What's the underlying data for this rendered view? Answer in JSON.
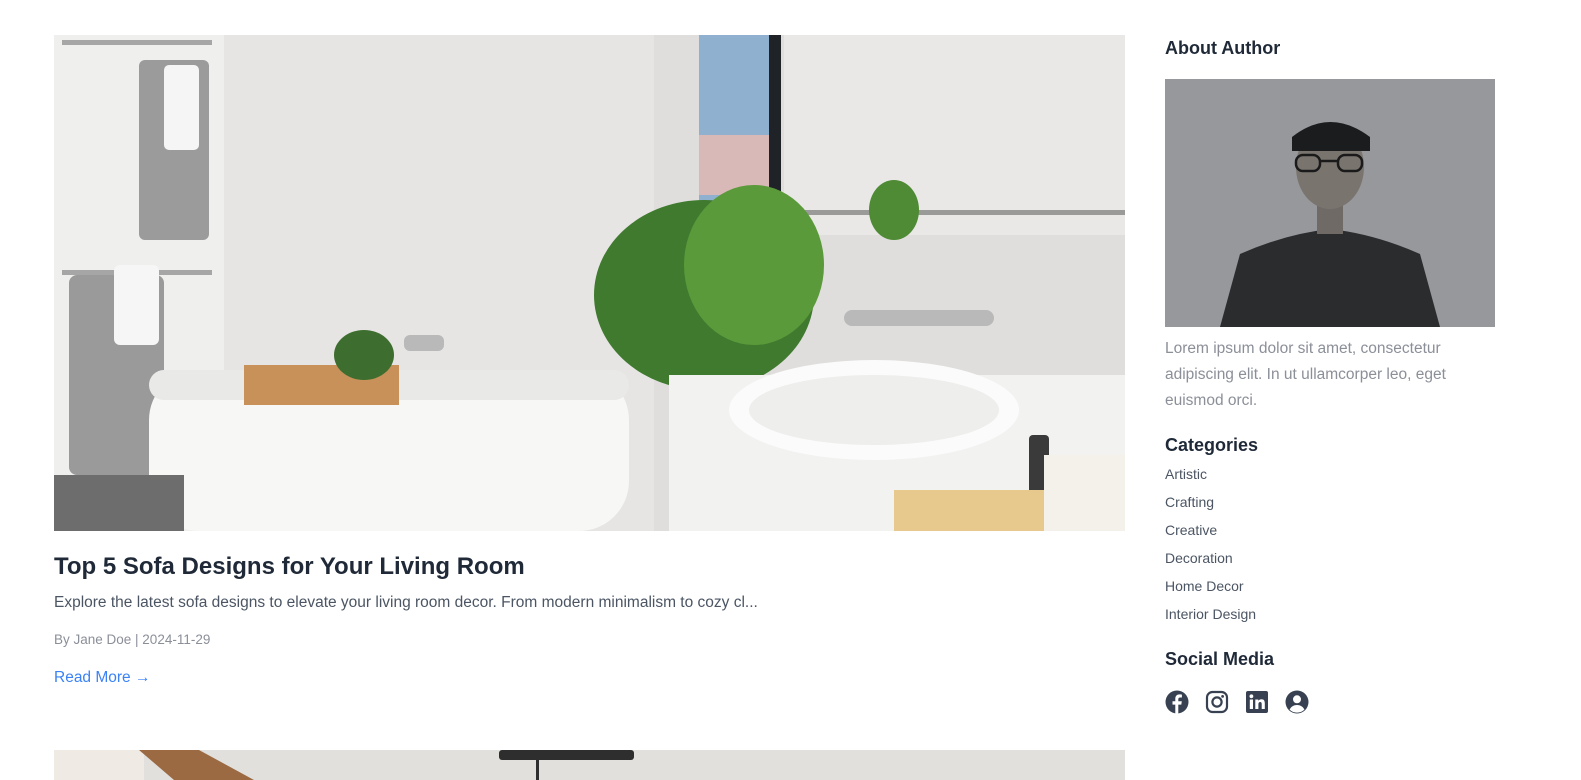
{
  "post": {
    "title": "Top 5 Sofa Designs for Your Living Room",
    "excerpt": "Explore the latest sofa designs to elevate your living room decor. From modern minimalism to cozy cl...",
    "meta": "By Jane Doe | 2024-11-29",
    "read_more": "Read More →"
  },
  "sidebar": {
    "about_heading": "About Author",
    "bio": "Lorem ipsum dolor sit amet, consectetur adipiscing elit. In ut ullamcorper leo, eget euismod orci.",
    "categories_heading": "Categories",
    "categories": [
      "Artistic",
      "Crafting",
      "Creative",
      "Decoration",
      "Home Decor",
      "Interior Design"
    ],
    "social_heading": "Social Media",
    "social_icons": [
      "facebook-icon",
      "instagram-icon",
      "linkedin-icon",
      "user-circle-icon"
    ]
  },
  "colors": {
    "heading": "#1f2937",
    "body_text": "#4b5563",
    "muted_text": "#8b8f98",
    "link": "#3b82f6"
  }
}
